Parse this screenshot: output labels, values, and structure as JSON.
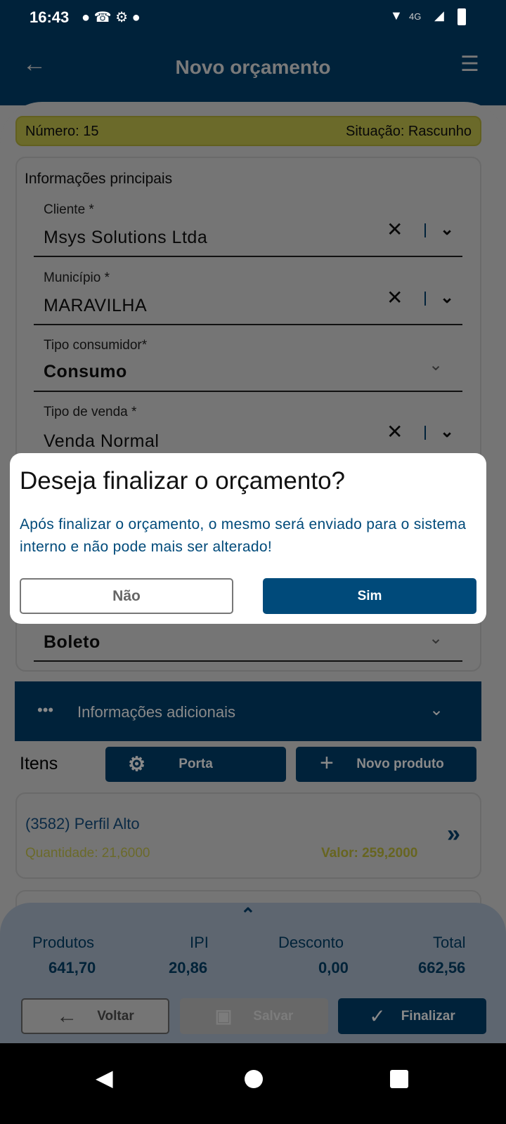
{
  "status_bar": {
    "time": "16:43",
    "network": "4G"
  },
  "header": {
    "title": "Novo orçamento"
  },
  "summary": {
    "numero": "Número: 15",
    "situacao": "Situação: Rascunho"
  },
  "main_info": {
    "title": "Informações principais",
    "fields": [
      {
        "label": "Cliente *",
        "value": "Msys Solutions Ltda"
      },
      {
        "label": "Município *",
        "value": "MARAVILHA"
      },
      {
        "label": "Tipo consumidor*",
        "value": "Consumo"
      },
      {
        "label": "Tipo de venda *",
        "value": "Venda Normal"
      },
      {
        "value": "Boleto"
      }
    ]
  },
  "additional": {
    "label": "Informações adicionais"
  },
  "items": {
    "title": "Itens",
    "porta_label": "Porta",
    "novo_produto_label": "Novo produto",
    "list": [
      {
        "name": "(3582) Perfil Alto",
        "quantidade": "Quantidade: 21,6000",
        "valor": "Valor: 259,2000"
      }
    ]
  },
  "totals": {
    "produtos_label": "Produtos",
    "produtos": "641,70",
    "ipi_label": "IPI",
    "ipi": "20,86",
    "desconto_label": "Desconto",
    "desconto": "0,00",
    "total_label": "Total",
    "total": "662,56"
  },
  "actions": {
    "voltar": "Voltar",
    "salvar": "Salvar",
    "finalizar": "Finalizar"
  },
  "dialog": {
    "title": "Deseja finalizar o orçamento?",
    "message": "Após finalizar o orçamento, o mesmo será enviado para o sistema interno e não pode mais ser alterado!",
    "no": "Não",
    "yes": "Sim"
  },
  "colors": {
    "primary": "#004b7f",
    "status_yellow": "#e9e65b",
    "accent_text": "#004a7a"
  }
}
